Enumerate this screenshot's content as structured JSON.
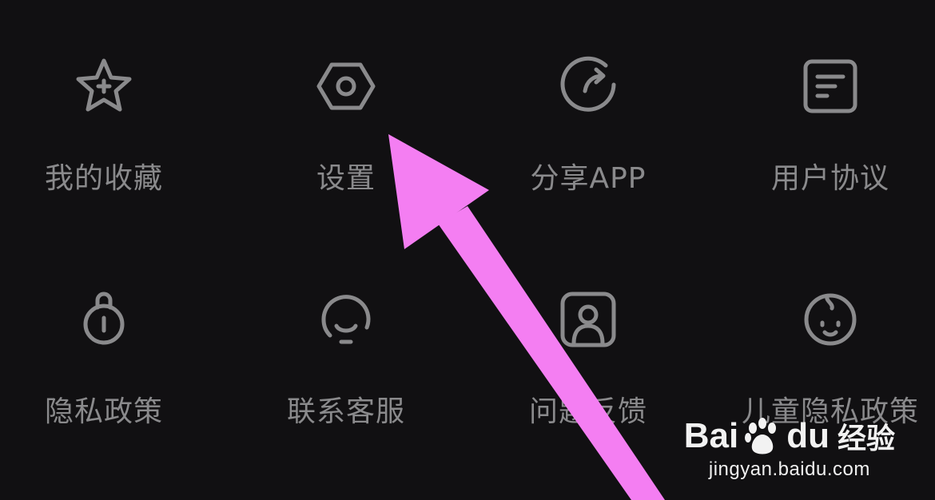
{
  "menu": {
    "items": [
      {
        "label": "我的收藏",
        "icon": "star-plus-icon"
      },
      {
        "label": "设置",
        "icon": "settings-hexagon-icon"
      },
      {
        "label": "分享APP",
        "icon": "share-refresh-icon"
      },
      {
        "label": "用户协议",
        "icon": "document-lines-icon"
      },
      {
        "label": "隐私政策",
        "icon": "lock-icon"
      },
      {
        "label": "联系客服",
        "icon": "headset-icon"
      },
      {
        "label": "问题反馈",
        "icon": "user-card-icon"
      },
      {
        "label": "儿童隐私政策",
        "icon": "baby-face-icon"
      }
    ]
  },
  "annotation": {
    "color": "#f47ef2"
  },
  "watermark": {
    "brand_left": "Bai",
    "brand_right": "du",
    "brand_cn": "经验",
    "url": "jingyan.baidu.com"
  }
}
